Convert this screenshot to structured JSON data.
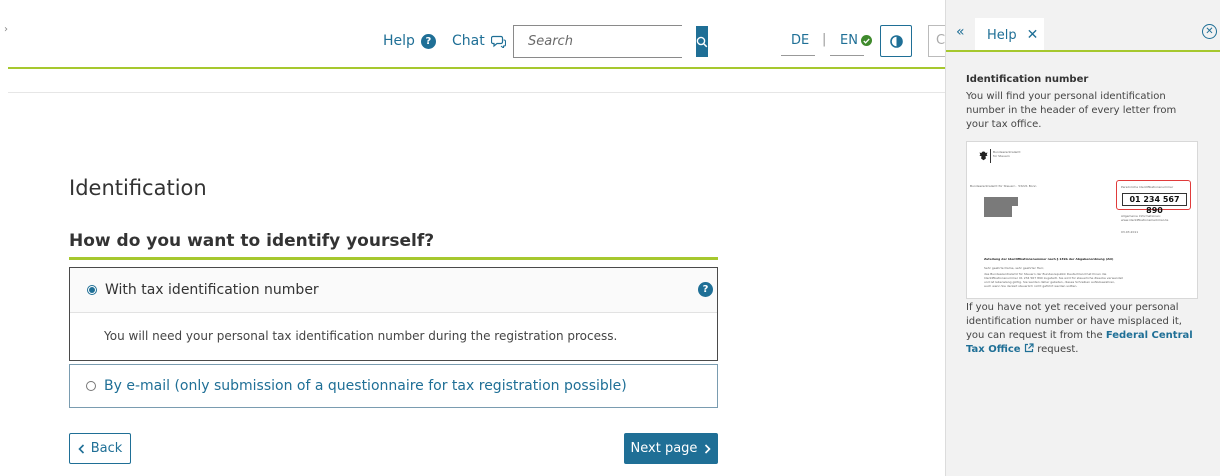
{
  "header": {
    "help_label": "Help",
    "chat_label": "Chat",
    "search_placeholder": "Search",
    "lang_de": "DE",
    "lang_separator": "|",
    "lang_en": "EN",
    "cut_button_label": "Ce"
  },
  "main": {
    "title": "Identification",
    "question": "How do you want to identify yourself?",
    "options": [
      {
        "label": "With tax identification number",
        "selected": true,
        "description": "You will need your personal tax identification number during the registration process."
      },
      {
        "label": "By e-mail (only submission of a questionnaire for tax registration possible)",
        "selected": false
      }
    ],
    "back_label": "Back",
    "next_label": "Next page"
  },
  "help_panel": {
    "tab_label": "Help",
    "heading": "Identification number",
    "text1": "You will find your personal identification number in the header of every letter from your tax office.",
    "text2_before": "If you have not yet received your personal identification number or have misplaced it, you can request it from the ",
    "text2_link": "Federal Central Tax Office",
    "text2_after": " request.",
    "letter": {
      "sender_line1": "Bundeszentralamt",
      "sender_line2": "für Steuern",
      "return_address": "Bundeszentralamt für Steuern · 53221 Bonn",
      "id_caption": "Persönliche Identifikationsnummer",
      "id_number": "01 234 567 890",
      "info_line1": "Allgemeine Informationen:",
      "info_line2": "www.identifikationsmerkmal.de",
      "date": "03.03.2011",
      "subject": "Zuteilung der Identifikationsnummer nach § 139b der Abgabenordnung (AO)",
      "salutation": "Sehr geehrte Dame, sehr geehrter Herr,",
      "body_line1": "das Bundeszentralamt für Steuern der Bundesrepublik Deutschland hat Ihnen die",
      "body_line2": "Identifikationsnummer 01 234 567 890 zugeteilt. Sie wird für steuerliche Zwecke verwendet",
      "body_line3": "und ist lebenslang gültig. Sie werden daher gebeten, dieses Schreiben aufzubewahren,",
      "body_line4": "auch wenn Sie derzeit steuerlich nicht geführt werden sollten."
    }
  },
  "colors": {
    "brand_blue": "#1f6f96",
    "accent_green": "#a6c82e",
    "check_green": "#3f8a2c",
    "highlight_red": "#e03b3b"
  },
  "icons": {
    "help": "question-circle-icon",
    "chat": "chat-bubble-icon",
    "search": "magnifier-icon",
    "en_selected": "check-circle-icon",
    "contrast": "contrast-icon",
    "collapse": "double-chevron-left-icon",
    "tab_close": "close-icon",
    "panel_close": "close-circle-icon",
    "external_link": "external-link-icon",
    "back": "chevron-left-icon",
    "next": "chevron-right-icon"
  }
}
